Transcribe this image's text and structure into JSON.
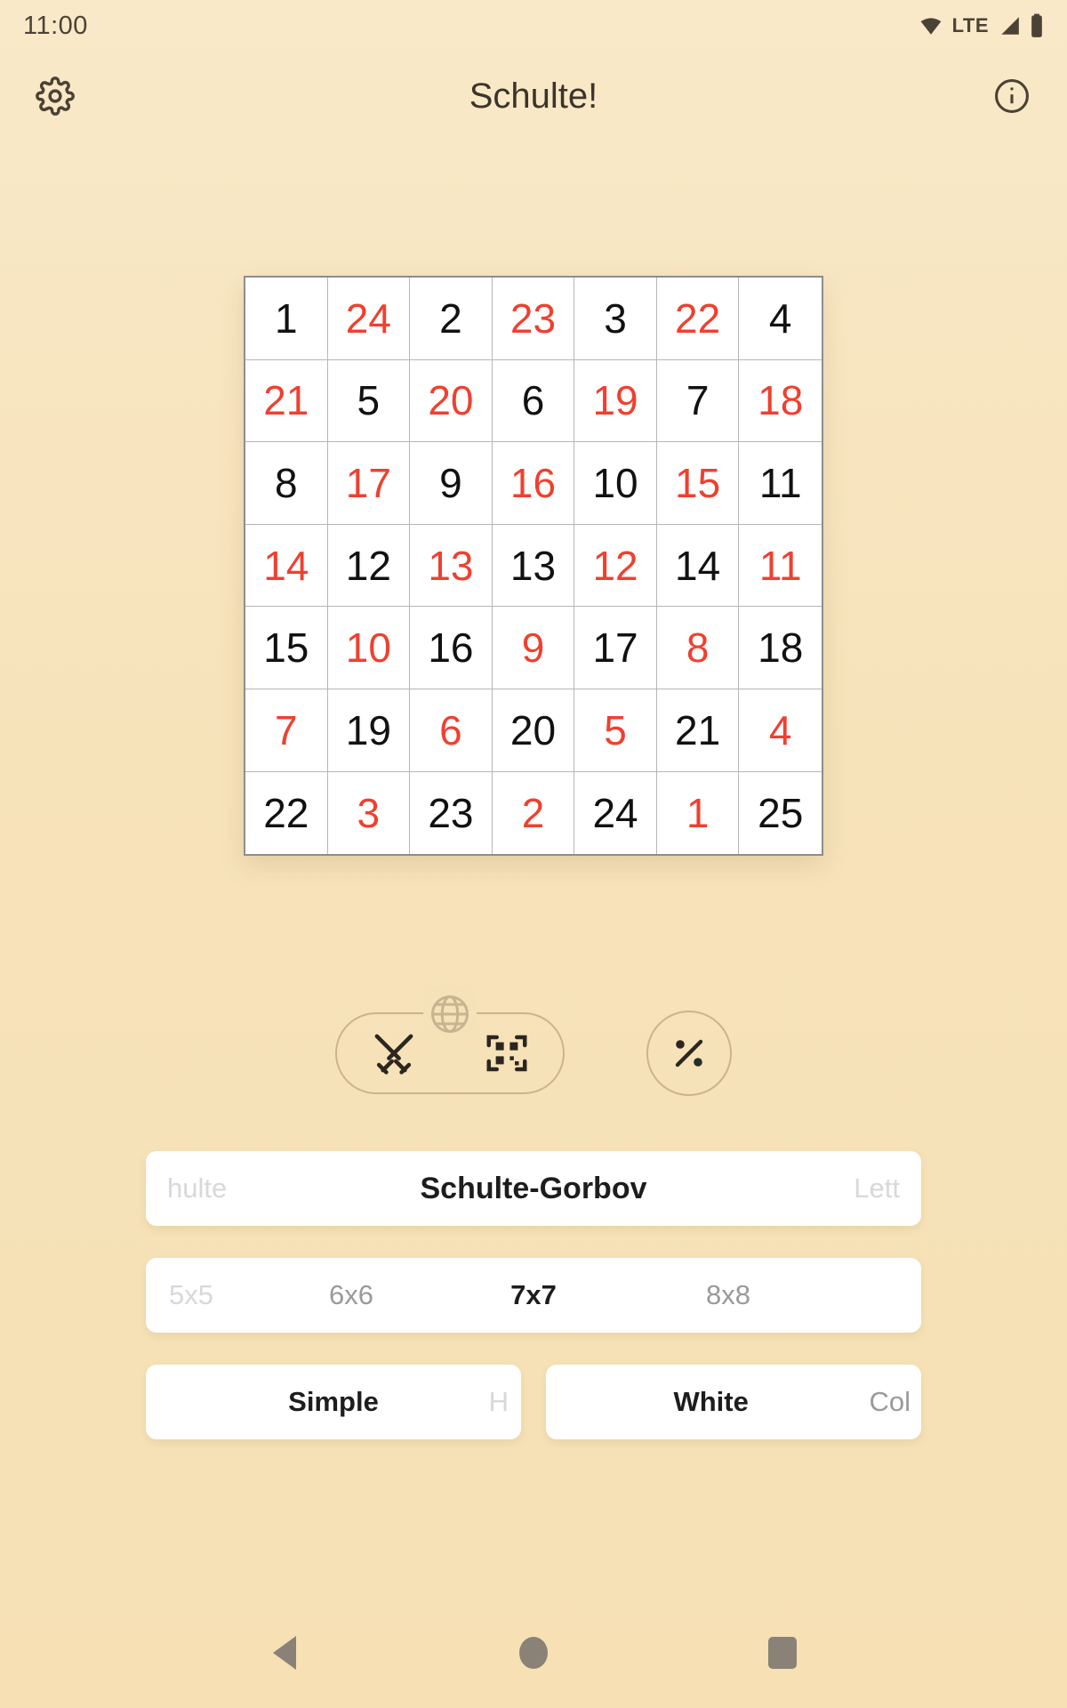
{
  "status_bar": {
    "time": "11:00",
    "network_label": "LTE",
    "icons": [
      "wifi-icon",
      "signal-icon",
      "battery-icon"
    ]
  },
  "app_bar": {
    "title": "Schulte!",
    "settings_icon": "gear-icon",
    "info_icon": "info-icon"
  },
  "board": {
    "rows": [
      [
        {
          "v": "1",
          "red": false
        },
        {
          "v": "24",
          "red": true
        },
        {
          "v": "2",
          "red": false
        },
        {
          "v": "23",
          "red": true
        },
        {
          "v": "3",
          "red": false
        },
        {
          "v": "22",
          "red": true
        },
        {
          "v": "4",
          "red": false
        }
      ],
      [
        {
          "v": "21",
          "red": true
        },
        {
          "v": "5",
          "red": false
        },
        {
          "v": "20",
          "red": true
        },
        {
          "v": "6",
          "red": false
        },
        {
          "v": "19",
          "red": true
        },
        {
          "v": "7",
          "red": false
        },
        {
          "v": "18",
          "red": true
        }
      ],
      [
        {
          "v": "8",
          "red": false
        },
        {
          "v": "17",
          "red": true
        },
        {
          "v": "9",
          "red": false
        },
        {
          "v": "16",
          "red": true
        },
        {
          "v": "10",
          "red": false
        },
        {
          "v": "15",
          "red": true
        },
        {
          "v": "11",
          "red": false
        }
      ],
      [
        {
          "v": "14",
          "red": true
        },
        {
          "v": "12",
          "red": false
        },
        {
          "v": "13",
          "red": true
        },
        {
          "v": "13",
          "red": false
        },
        {
          "v": "12",
          "red": true
        },
        {
          "v": "14",
          "red": false
        },
        {
          "v": "11",
          "red": true
        }
      ],
      [
        {
          "v": "15",
          "red": false
        },
        {
          "v": "10",
          "red": true
        },
        {
          "v": "16",
          "red": false
        },
        {
          "v": "9",
          "red": true
        },
        {
          "v": "17",
          "red": false
        },
        {
          "v": "8",
          "red": true
        },
        {
          "v": "18",
          "red": false
        }
      ],
      [
        {
          "v": "7",
          "red": true
        },
        {
          "v": "19",
          "red": false
        },
        {
          "v": "6",
          "red": true
        },
        {
          "v": "20",
          "red": false
        },
        {
          "v": "5",
          "red": true
        },
        {
          "v": "21",
          "red": false
        },
        {
          "v": "4",
          "red": true
        }
      ],
      [
        {
          "v": "22",
          "red": false
        },
        {
          "v": "3",
          "red": true
        },
        {
          "v": "23",
          "red": false
        },
        {
          "v": "2",
          "red": true
        },
        {
          "v": "24",
          "red": false
        },
        {
          "v": "1",
          "red": true
        },
        {
          "v": "25",
          "red": false
        }
      ]
    ],
    "black_color": "#111111",
    "red_color": "#ef4030"
  },
  "controls": {
    "globe_icon": "globe-icon",
    "swords_icon": "crossed-swords-icon",
    "qr_icon": "qr-code-icon",
    "percent_icon": "percent-icon"
  },
  "pickers": {
    "mode": {
      "prev": "hulte",
      "selected": "Schulte-Gorbov",
      "next": "Lett"
    },
    "size": {
      "options": [
        "5x5",
        "6x6",
        "7x7",
        "8x8"
      ],
      "selected": "7x7",
      "faint": "5x5"
    },
    "style": {
      "selected": "Simple",
      "next": "H"
    },
    "color": {
      "selected": "White",
      "next": "Col"
    }
  },
  "nav_bar": {
    "back": "back-button",
    "home": "home-button",
    "recents": "recents-button"
  },
  "theme": {
    "background": "#f7e3bb",
    "accent_outline": "#cbb48b",
    "text": "#3b342b"
  }
}
